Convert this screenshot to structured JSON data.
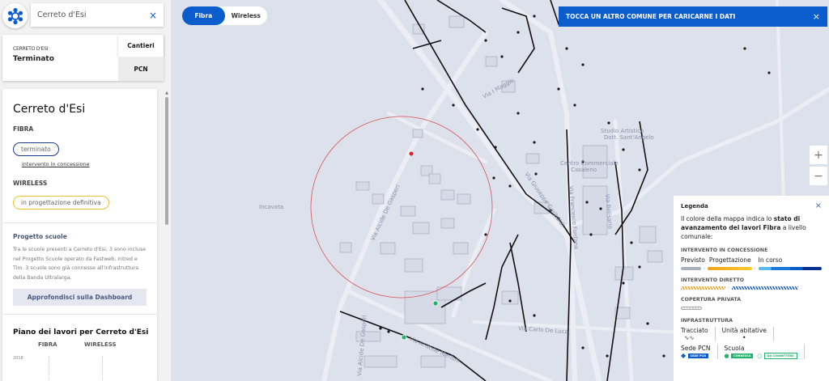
{
  "search": {
    "value": "Cerreto d'Esi",
    "clear_icon": "×"
  },
  "info": {
    "comune": "CERRETO D'ESI",
    "status": "Terminato",
    "btn_cantieri": "Cantieri",
    "btn_pcn": "PCN"
  },
  "panel": {
    "title": "Cerreto d'Esi",
    "fibra_label": "FIBRA",
    "fibra_status": "terminato",
    "fibra_link": "intervento in concessione",
    "wireless_label": "WIRELESS",
    "wireless_status": "in progettazione definitiva",
    "scuole_title": "Progetto scuole",
    "scuole_text": "Tra le scuole presenti a Cerreto d'Esi, 3 sono incluse nel Progetto Scuole operato da Fastweb, Intred e Tim. 3 scuole sono già connesse all'infrastruttura della Banda Ultralarga.",
    "dashboard_btn": "Approfondisci sulla Dashboard",
    "piano_title": "Piano dei lavori per Cerreto d'Esi",
    "col_fibra": "FIBRA",
    "col_wireless": "WIRELESS",
    "year": "2018"
  },
  "toggle": {
    "fibra": "Fibra",
    "wireless": "Wireless",
    "active": "fibra"
  },
  "banner": {
    "text": "TOCCA UN ALTRO COMUNE PER CARICARNE I DATI",
    "close": "×"
  },
  "zoom": {
    "in": "+",
    "out": "−"
  },
  "map_labels": {
    "incavata": "Incavata",
    "maggio": "Via I Maggio",
    "studio1": "Studio Artistico",
    "studio2": "Dott. Sant'Angelo",
    "centro1": "Centro Commerciale",
    "centro2": "Casaleno",
    "degasperi": "Via Alcide De Gasperi",
    "degasperi2": "Via Alcide De Gasperi",
    "garibaldi": "Via Giuseppe Garibaldi",
    "fontana": "Via Francesco Fontana",
    "belisario": "Via Belisario",
    "merloni": "Via Aristide Merloni",
    "deluca": "Via Carlo De Luca"
  },
  "legend": {
    "title": "Legenda",
    "close": "×",
    "desc_pre": "Il colore della mappa indica lo ",
    "desc_bold": "stato di avanzamento dei lavori Fibra",
    "desc_post": " a livello comunale:",
    "concessione": "INTERVENTO IN CONCESSIONE",
    "previsto": "Previsto",
    "progettazione": "Progettazione",
    "in_corso": "In corso",
    "diretto": "INTERVENTO DIRETTO",
    "privata": "COPERTURA PRIVATA",
    "infrastruttura": "INFRASTRUTTURA",
    "tracciato": "Tracciato",
    "unita": "Unità abitative",
    "sede_pcn": "Sede PCN",
    "scuola": "Scuola",
    "tag_sede": "SEDE PCN",
    "tag_connessa": "CONNESSA",
    "tag_da": "DA CONNETTERE"
  },
  "colors": {
    "accent": "#0b5ccc",
    "map_bg": "#dde1ec",
    "fibra_border": "#1c3a8c",
    "wireless_border": "#f0c030",
    "school": "#1db36b",
    "marker": "#e0202a"
  }
}
